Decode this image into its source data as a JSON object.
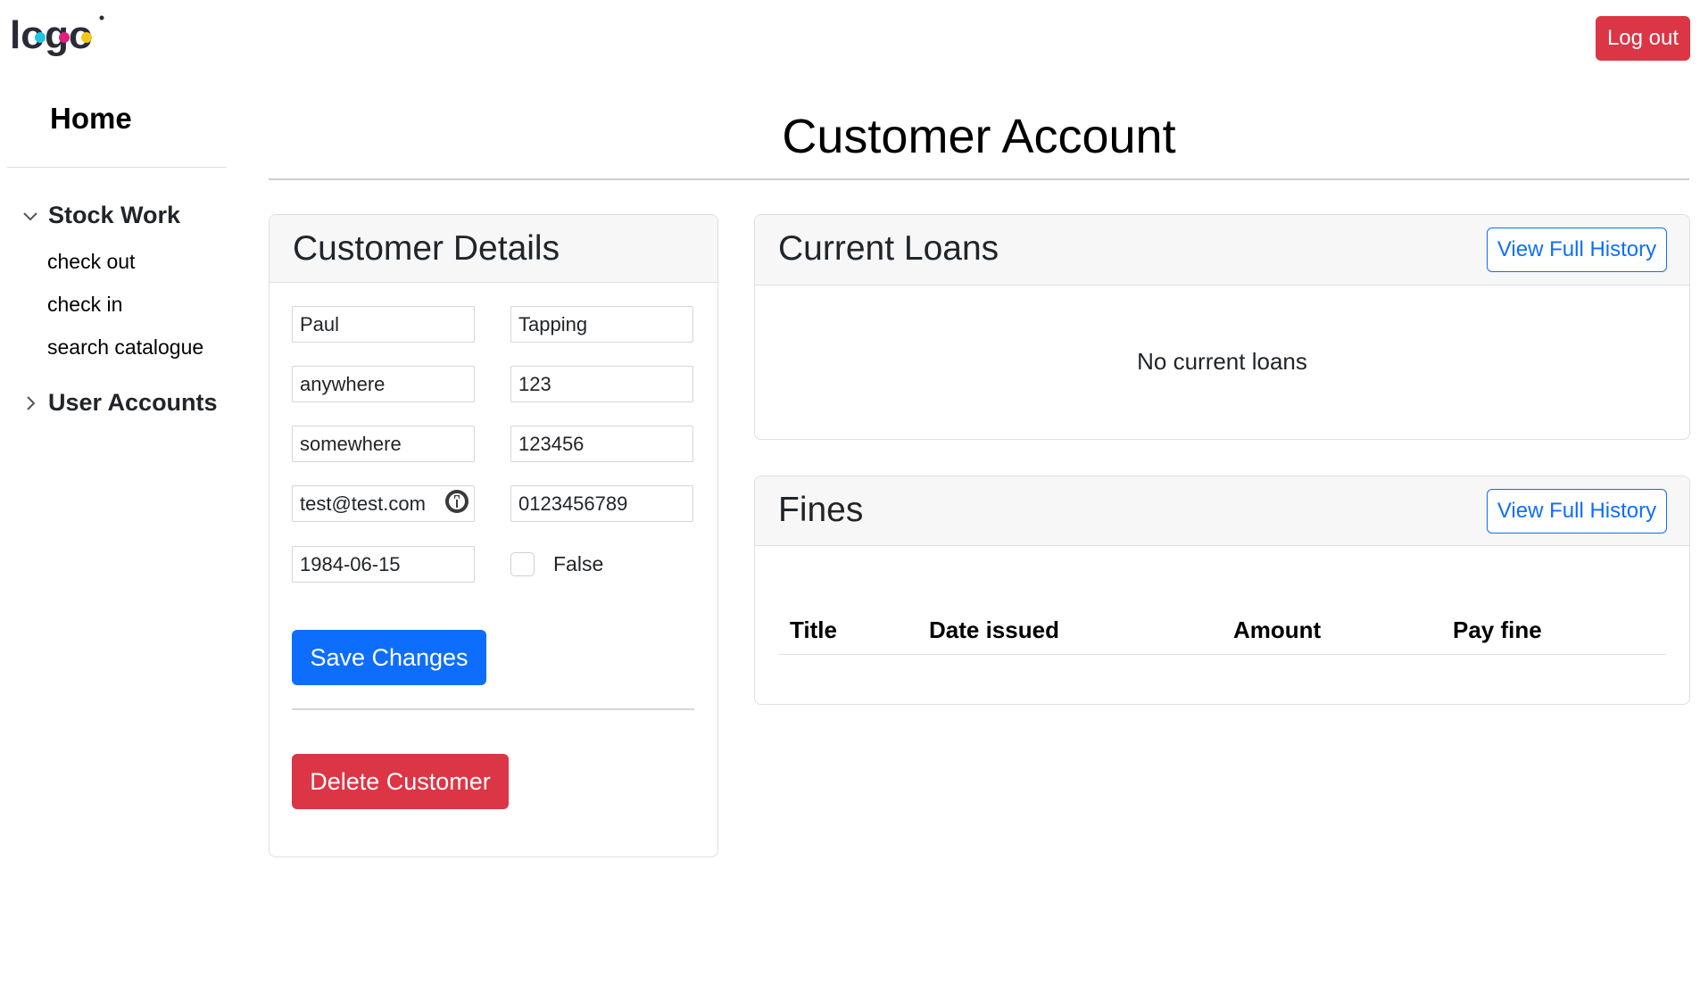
{
  "header": {
    "logo_text": "logo",
    "logout_label": "Log out",
    "colors": {
      "danger": "#dc3545",
      "primary": "#0d6efd",
      "logo_dark": "#2b2b38",
      "logo_cyan": "#21c4e0",
      "logo_pink": "#e01f7b",
      "logo_yellow": "#f5c518"
    }
  },
  "sidebar": {
    "home_label": "Home",
    "groups": [
      {
        "label": "Stock Work",
        "expanded": true,
        "icon": "chevron-down-icon",
        "items": [
          {
            "label": "check out"
          },
          {
            "label": "check in"
          },
          {
            "label": "search catalogue"
          }
        ]
      },
      {
        "label": "User Accounts",
        "expanded": false,
        "icon": "chevron-right-icon",
        "items": []
      }
    ]
  },
  "page": {
    "title": "Customer Account"
  },
  "customer_details": {
    "title": "Customer Details",
    "first_name": "Paul",
    "last_name": "Tapping",
    "address_line1": "anywhere",
    "house_number": "123",
    "address_line2": "somewhere",
    "postcode": "123456",
    "email": "test@test.com",
    "phone": "0123456789",
    "dob": "1984-06-15",
    "flag_checked": false,
    "flag_label": "False",
    "save_label": "Save Changes",
    "delete_label": "Delete Customer"
  },
  "current_loans": {
    "title": "Current Loans",
    "history_label": "View Full History",
    "empty_text": "No current loans"
  },
  "fines": {
    "title": "Fines",
    "history_label": "View Full History",
    "columns": [
      "Title",
      "Date issued",
      "Amount",
      "Pay fine"
    ]
  }
}
